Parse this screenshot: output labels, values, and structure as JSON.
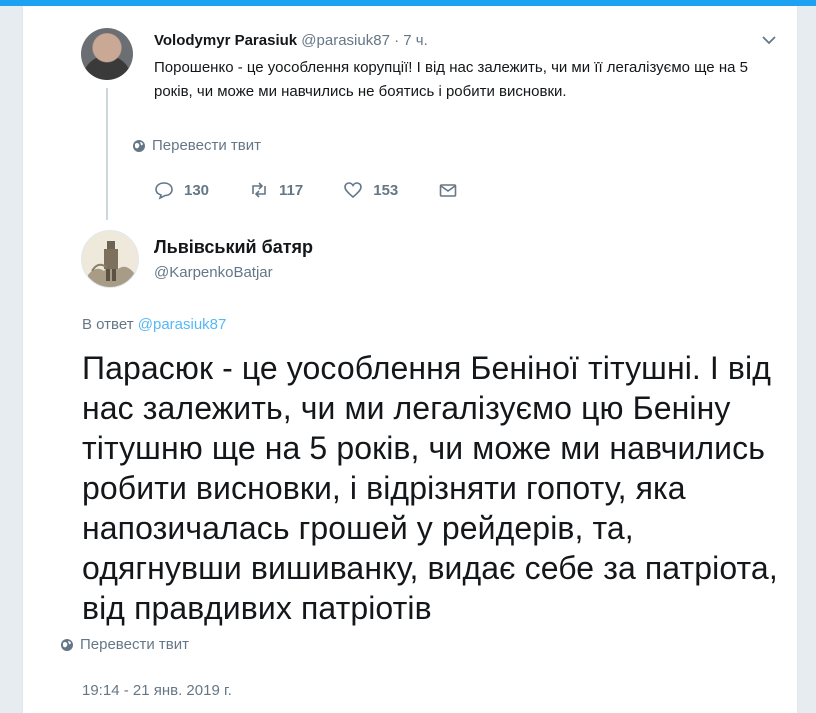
{
  "parent_tweet": {
    "author_name": "Volodymyr Parasiuk",
    "author_handle": "@parasiuk87",
    "time": "· 7 ч.",
    "text": "Порошенко - це уособлення корупції! І від нас залежить, чи ми її легалізуємо ще на 5 років, чи може ми навчились не боятись і робити висновки.",
    "translate_label": "Перевести твит",
    "replies": "130",
    "retweets": "117",
    "likes": "153"
  },
  "main_tweet": {
    "author_name": "Львівський батяр",
    "author_handle": "@KarpenkoBatjar",
    "reply_prefix": "В ответ",
    "reply_to": "@parasiuk87",
    "text": "Парасюк - це уособлення Беніної тітушні. І від нас залежить, чи ми легалізуємо цю Беніну тітушню ще на 5 років, чи може ми навчились робити висновки, і відрізняти гопоту, яка напозичалась грошей у рейдерів, та, одягнувши вишиванку, видає себе за патріота, від правдивих патріотів",
    "translate_label": "Перевести твит",
    "timestamp": "19:14 - 21 янв. 2019 г."
  },
  "icons": {
    "reply": "reply-icon",
    "retweet": "retweet-icon",
    "like": "heart-icon",
    "dm": "envelope-icon",
    "translate": "globe-icon",
    "more": "chevron-down-icon"
  },
  "colors": {
    "accent": "#1da1f2",
    "secondary_text": "#657786",
    "primary_text": "#14171a"
  }
}
